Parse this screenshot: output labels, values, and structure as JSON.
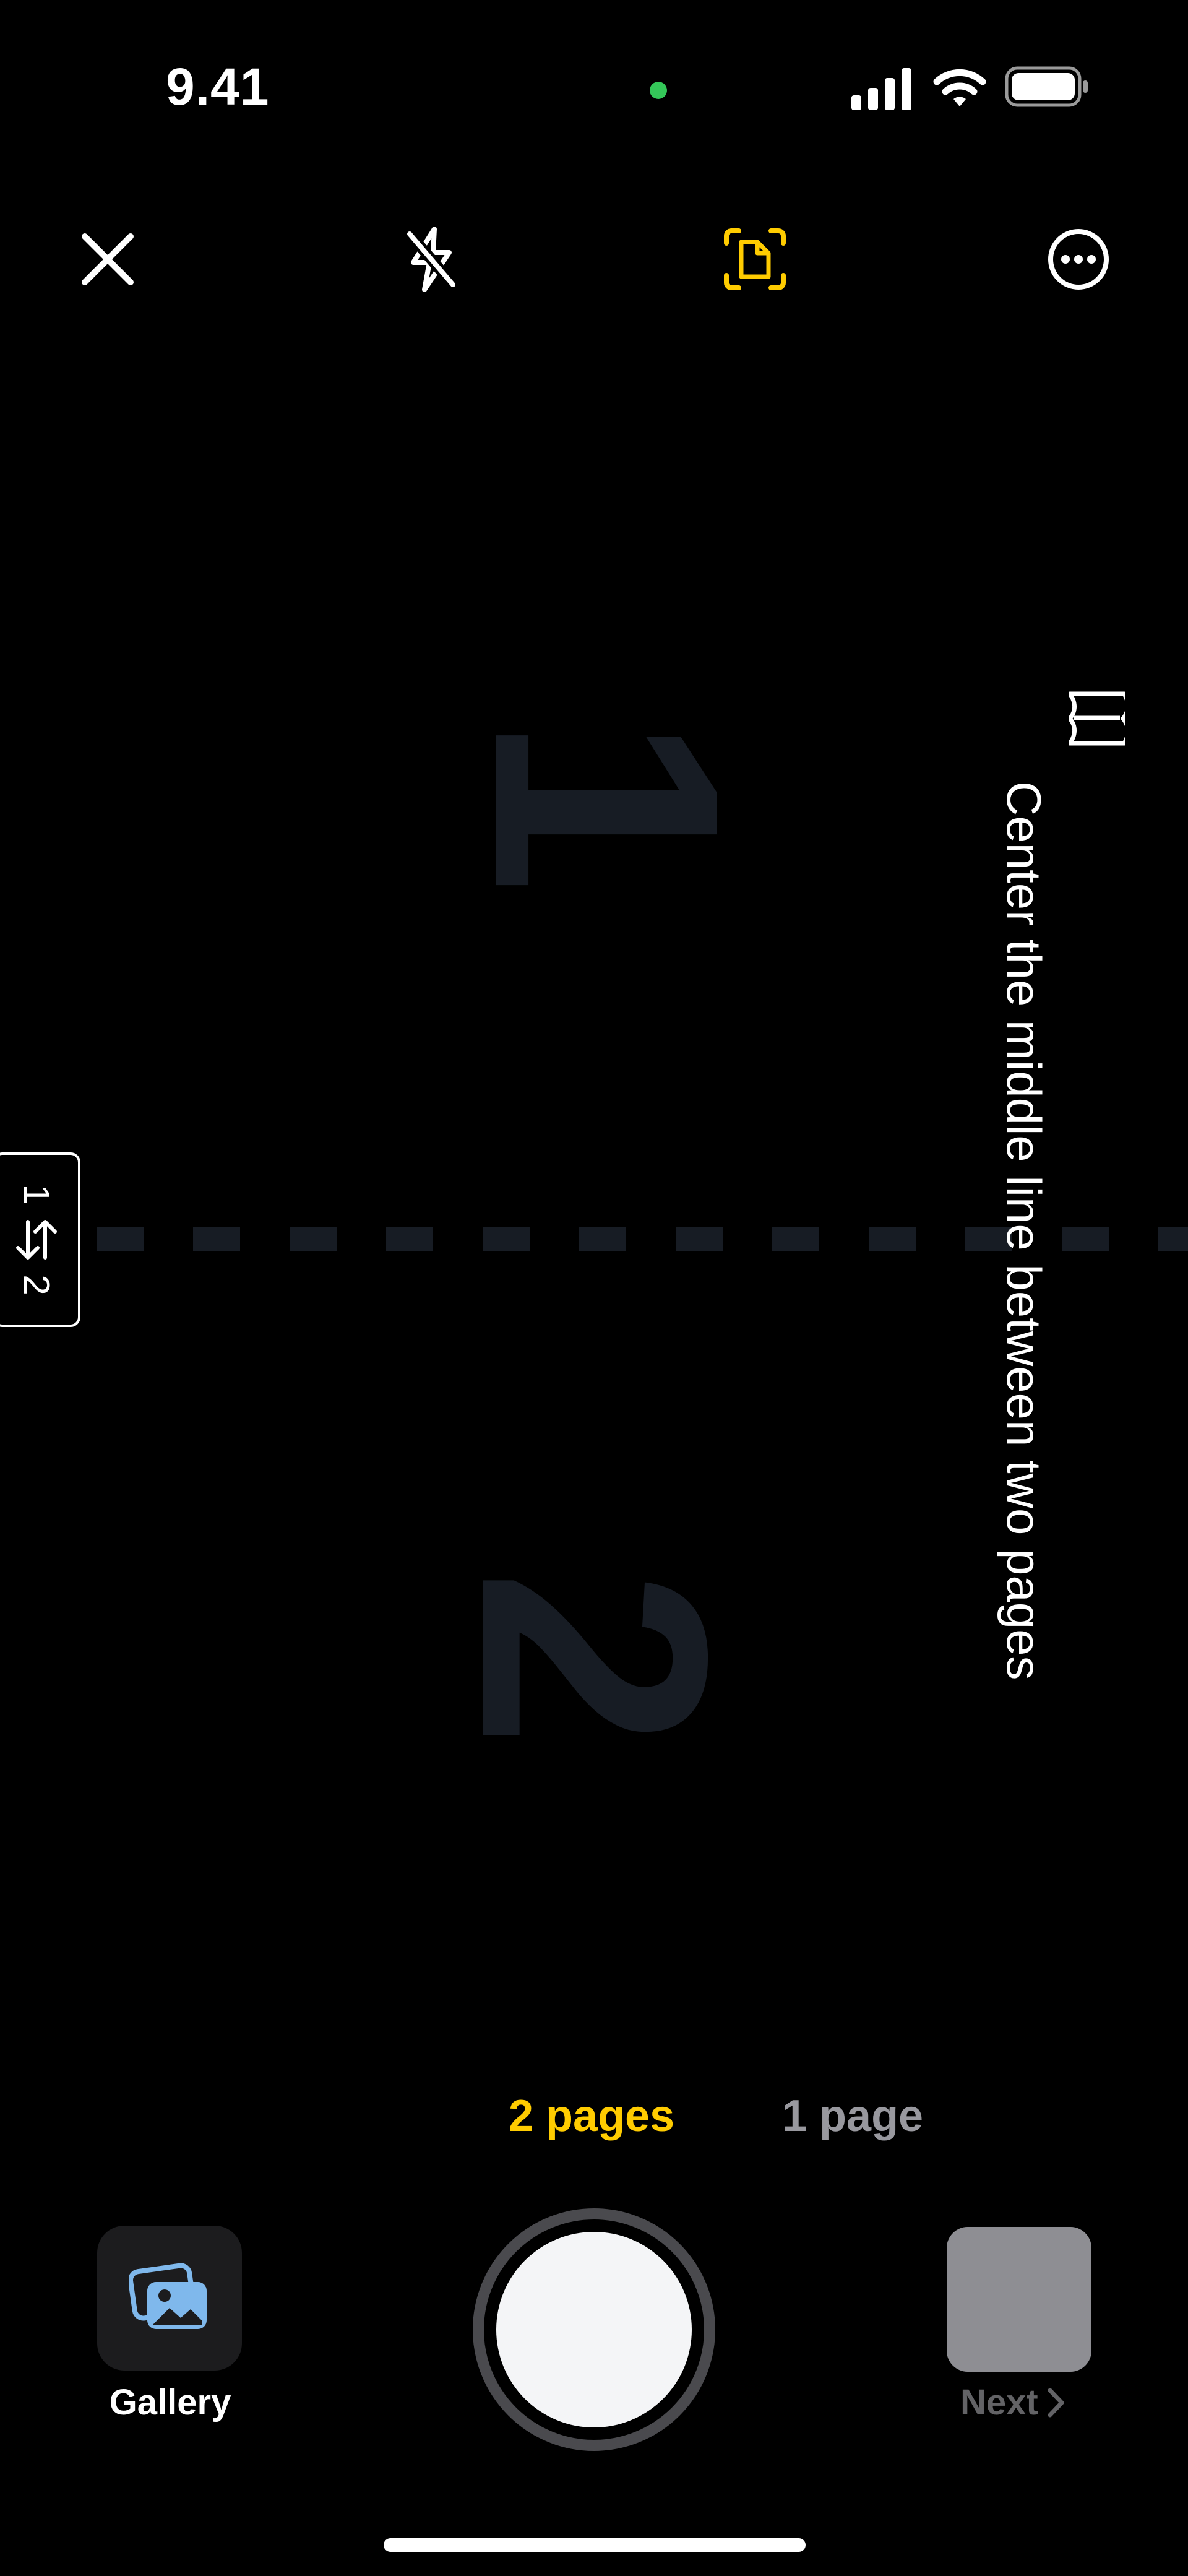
{
  "status_bar": {
    "time": "9.41",
    "icons": [
      "mic-active-dot",
      "cellular-signal-icon",
      "wifi-icon",
      "battery-icon"
    ]
  },
  "toolbar": {
    "close_icon": "close-icon",
    "flash_icon": "flash-off-icon",
    "mode_icon": "document-scan-icon",
    "more_icon": "more-icon",
    "accent_color": "#ffcc00"
  },
  "viewfinder": {
    "page_top": "1",
    "page_bottom": "2",
    "order_toggle": {
      "top": "1",
      "bottom": "2",
      "icon": "swap-arrows-icon"
    },
    "hint": "Center the middle line between two pages",
    "hint_icon": "open-book-icon"
  },
  "page_modes": {
    "selected": "2 pages",
    "other": "1 page"
  },
  "bottom_bar": {
    "gallery_label": "Gallery",
    "next_label": "Next"
  }
}
